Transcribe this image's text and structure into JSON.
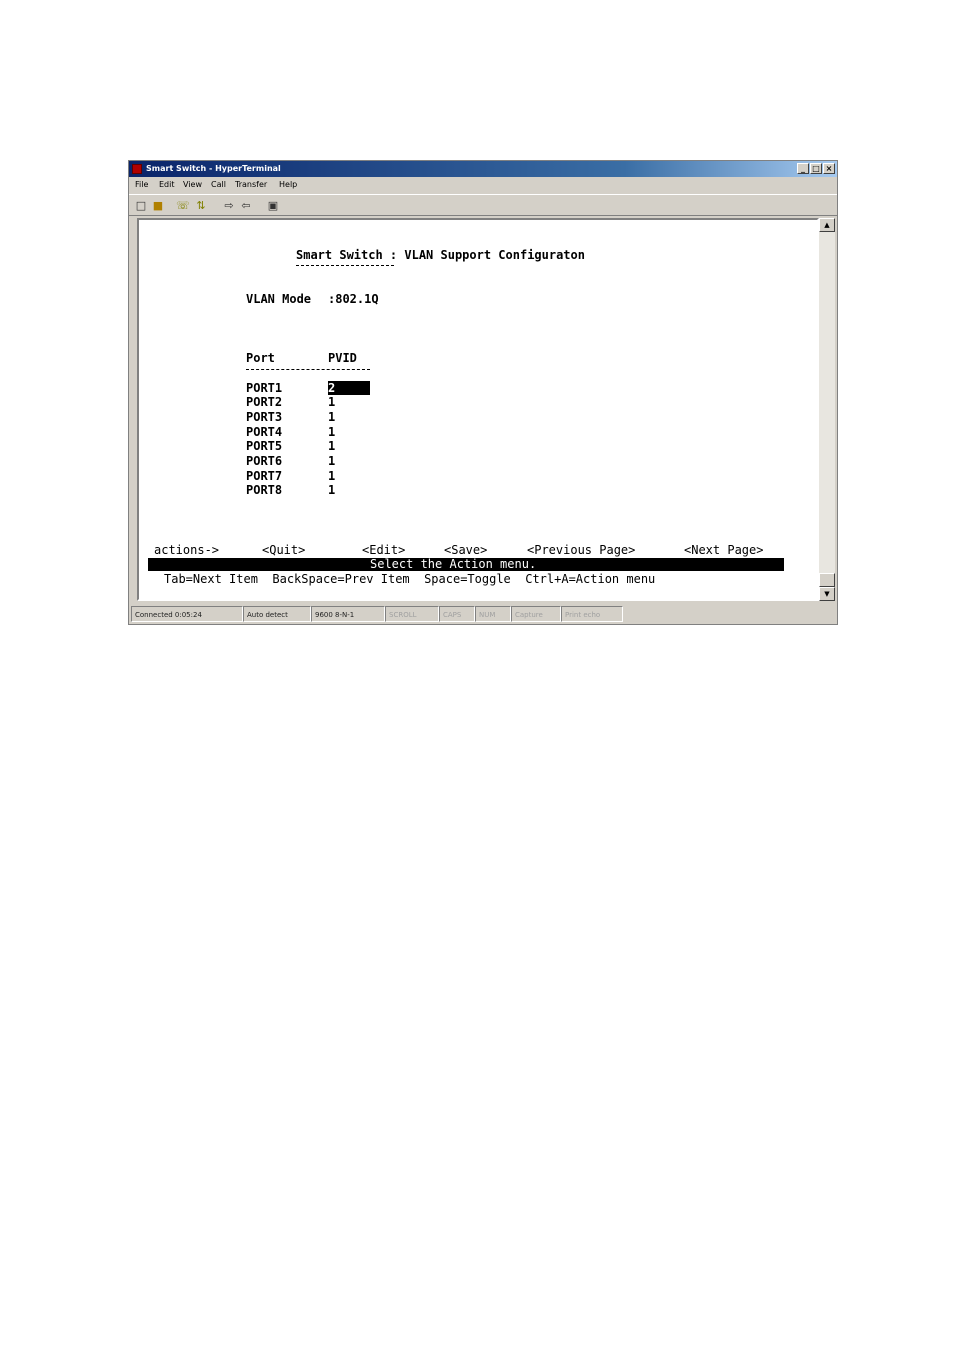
{
  "window": {
    "title": "Smart Switch - HyperTerminal",
    "controls": [
      "_",
      "□",
      "×"
    ]
  },
  "menu": [
    "File",
    "Edit",
    "View",
    "Call",
    "Transfer",
    "Help"
  ],
  "toolbar_icons": [
    "new-icon",
    "open-icon",
    "connect-icon",
    "disconnect-icon",
    "send-icon",
    "receive-icon",
    "properties-icon"
  ],
  "terminal": {
    "header": "Smart Switch : VLAN Support Configuraton",
    "vlan_mode_label": "VLAN Mode",
    "vlan_mode_value": ":802.1Q",
    "col_port": "Port",
    "col_pvid": "PVID",
    "ports": [
      {
        "port": "PORT1",
        "pvid": "2"
      },
      {
        "port": "PORT2",
        "pvid": "1"
      },
      {
        "port": "PORT3",
        "pvid": "1"
      },
      {
        "port": "PORT4",
        "pvid": "1"
      },
      {
        "port": "PORT5",
        "pvid": "1"
      },
      {
        "port": "PORT6",
        "pvid": "1"
      },
      {
        "port": "PORT7",
        "pvid": "1"
      },
      {
        "port": "PORT8",
        "pvid": "1"
      }
    ],
    "actions_label": "actions->",
    "actions": [
      "<Quit>",
      "<Edit>",
      "<Save>",
      "<Previous Page>",
      "<Next Page>"
    ],
    "status_message": "Select the Action menu.",
    "help": "Tab=Next Item  BackSpace=Prev Item  Space=Toggle  Ctrl+A=Action menu"
  },
  "statusbar": {
    "connected": "Connected 0:05:24",
    "detect": "Auto detect",
    "settings": "9600 8-N-1",
    "scroll": "SCROLL",
    "caps": "CAPS",
    "num": "NUM",
    "capture": "Capture",
    "print_echo": "Print echo"
  }
}
